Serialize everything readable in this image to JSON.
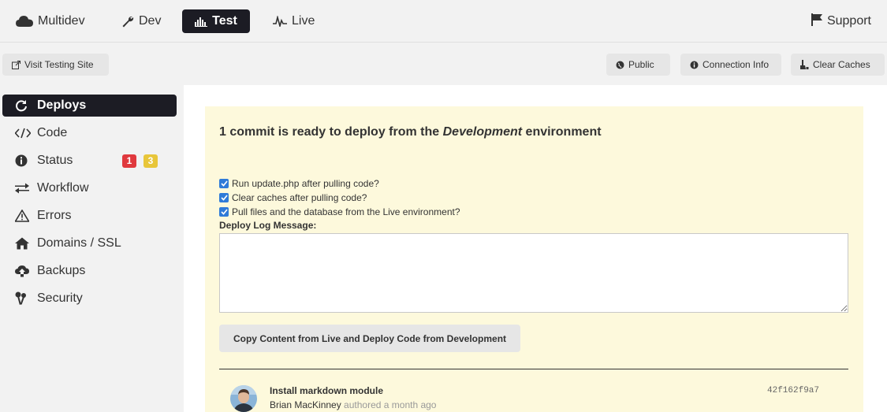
{
  "nav": {
    "multidev": "Multidev",
    "dev": "Dev",
    "test": "Test",
    "live": "Live",
    "support": "Support"
  },
  "toolbar": {
    "visit": "Visit Testing Site",
    "public": "Public",
    "connection": "Connection Info",
    "clear_caches": "Clear Caches"
  },
  "sidebar": {
    "items": [
      {
        "label": "Deploys",
        "icon": "refresh-icon"
      },
      {
        "label": "Code",
        "icon": "code-icon"
      },
      {
        "label": "Status",
        "icon": "info-icon"
      },
      {
        "label": "Workflow",
        "icon": "swap-icon"
      },
      {
        "label": "Errors",
        "icon": "warning-icon"
      },
      {
        "label": "Domains / SSL",
        "icon": "home-icon"
      },
      {
        "label": "Backups",
        "icon": "cloud-upload-icon"
      },
      {
        "label": "Security",
        "icon": "keys-icon"
      }
    ],
    "status_badges": {
      "red": "1",
      "yellow": "3"
    }
  },
  "deploy": {
    "title_pre": "1 commit is ready to deploy from the ",
    "title_env": "Development",
    "title_post": " environment",
    "options": [
      "Run update.php after pulling code?",
      "Clear caches after pulling code?",
      "Pull files and the database from the Live environment?"
    ],
    "log_label": "Deploy Log Message:",
    "log_value": "",
    "button": "Copy Content from Live and Deploy Code from Development"
  },
  "commit": {
    "message": "Install markdown module",
    "author": "Brian MacKinney",
    "meta": " authored a month ago",
    "hash": "42f162f9a7"
  },
  "colors": {
    "active_bg": "#1c1c24",
    "panel_bg": "#fdf9dc",
    "badge_red": "#e0393e",
    "badge_yellow": "#e8c63a",
    "checkbox": "#2f7bd8"
  }
}
